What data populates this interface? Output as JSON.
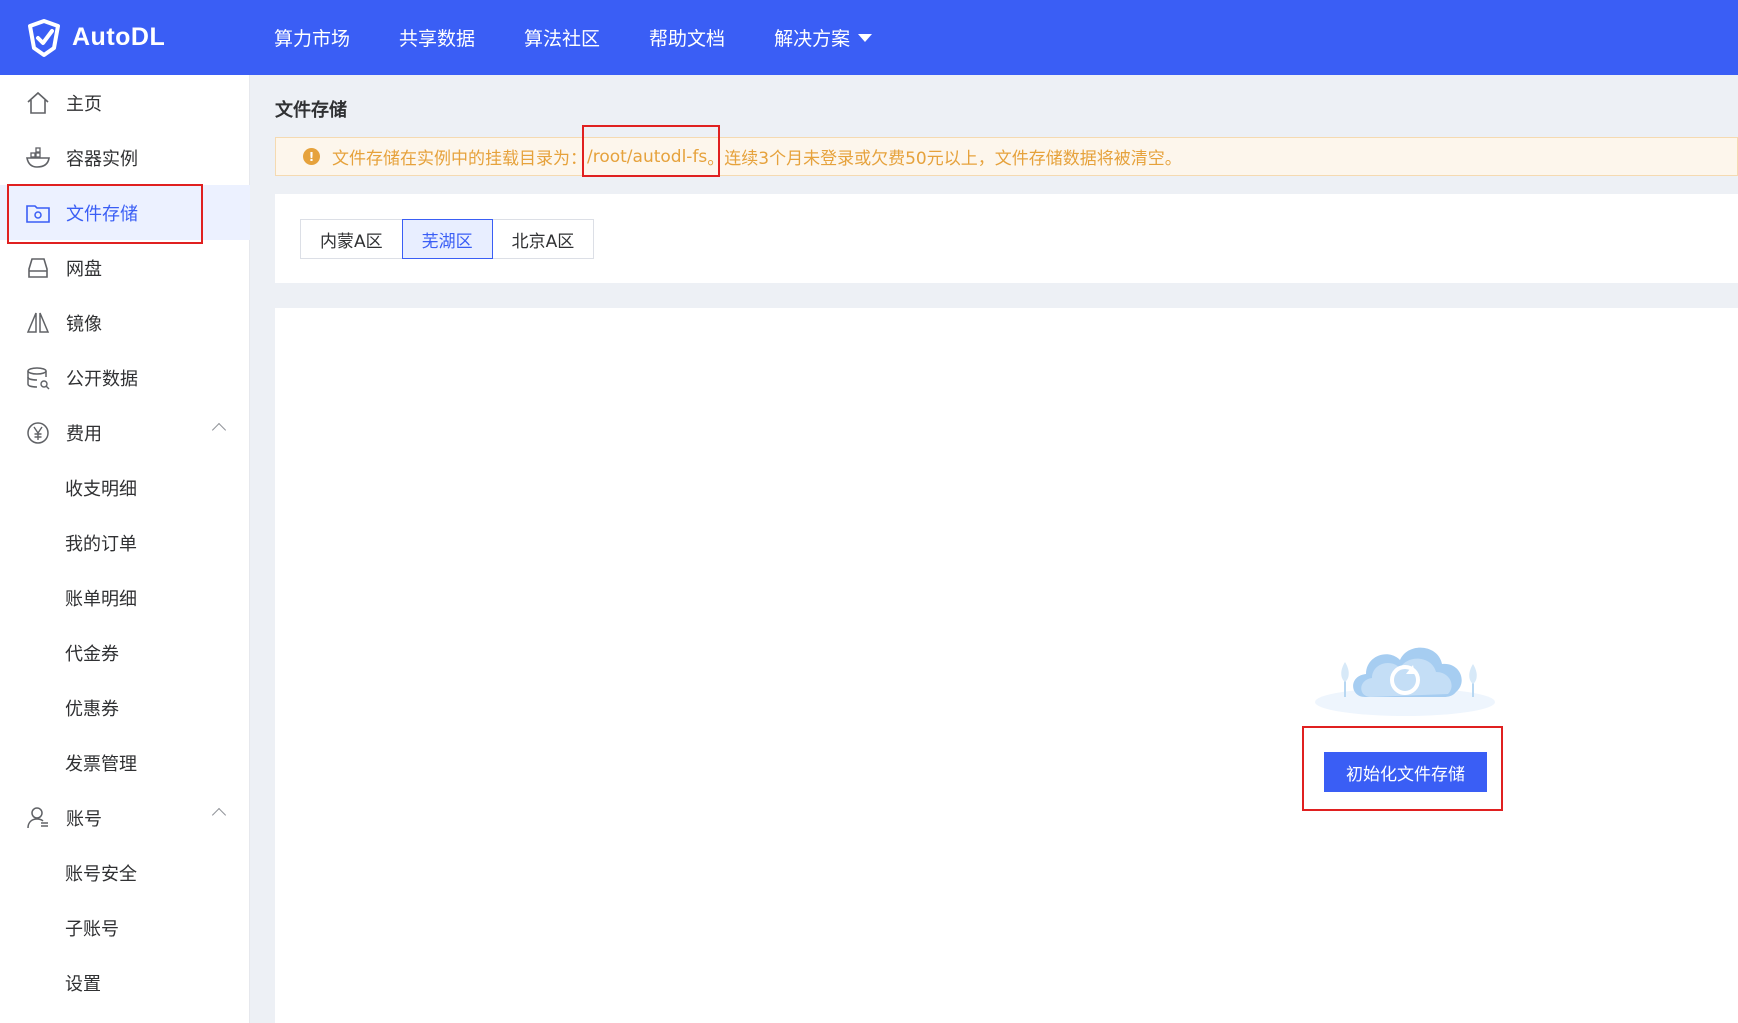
{
  "header": {
    "logo_text": "AutoDL",
    "nav": [
      "算力市场",
      "共享数据",
      "算法社区",
      "帮助文档",
      "解决方案"
    ]
  },
  "sidebar": {
    "items": [
      {
        "label": "主页",
        "icon": "home-icon"
      },
      {
        "label": "容器实例",
        "icon": "container-icon"
      },
      {
        "label": "文件存储",
        "icon": "folder-settings-icon",
        "active": true
      },
      {
        "label": "网盘",
        "icon": "disk-icon"
      },
      {
        "label": "镜像",
        "icon": "mirror-icon"
      },
      {
        "label": "公开数据",
        "icon": "database-icon"
      },
      {
        "label": "费用",
        "icon": "yen-icon",
        "expanded": true
      },
      {
        "label": "收支明细"
      },
      {
        "label": "我的订单"
      },
      {
        "label": "账单明细"
      },
      {
        "label": "代金券"
      },
      {
        "label": "优惠券"
      },
      {
        "label": "发票管理"
      },
      {
        "label": "账号",
        "icon": "user-icon",
        "expanded": true
      },
      {
        "label": "账号安全"
      },
      {
        "label": "子账号"
      },
      {
        "label": "设置"
      }
    ]
  },
  "main": {
    "title": "文件存储",
    "alert": {
      "prefix": "文件存储在实例中的挂载目录为：",
      "path": "/root/autodl-fs",
      "suffix": "。连续3个月未登录或欠费50元以上，文件存储数据将被清空。"
    },
    "regions": [
      "内蒙A区",
      "芜湖区",
      "北京A区"
    ],
    "active_region": "芜湖区",
    "init_button": "初始化文件存储"
  },
  "colors": {
    "primary": "#3a5ef5",
    "warning": "#e6a23c",
    "highlight": "#e02020"
  }
}
